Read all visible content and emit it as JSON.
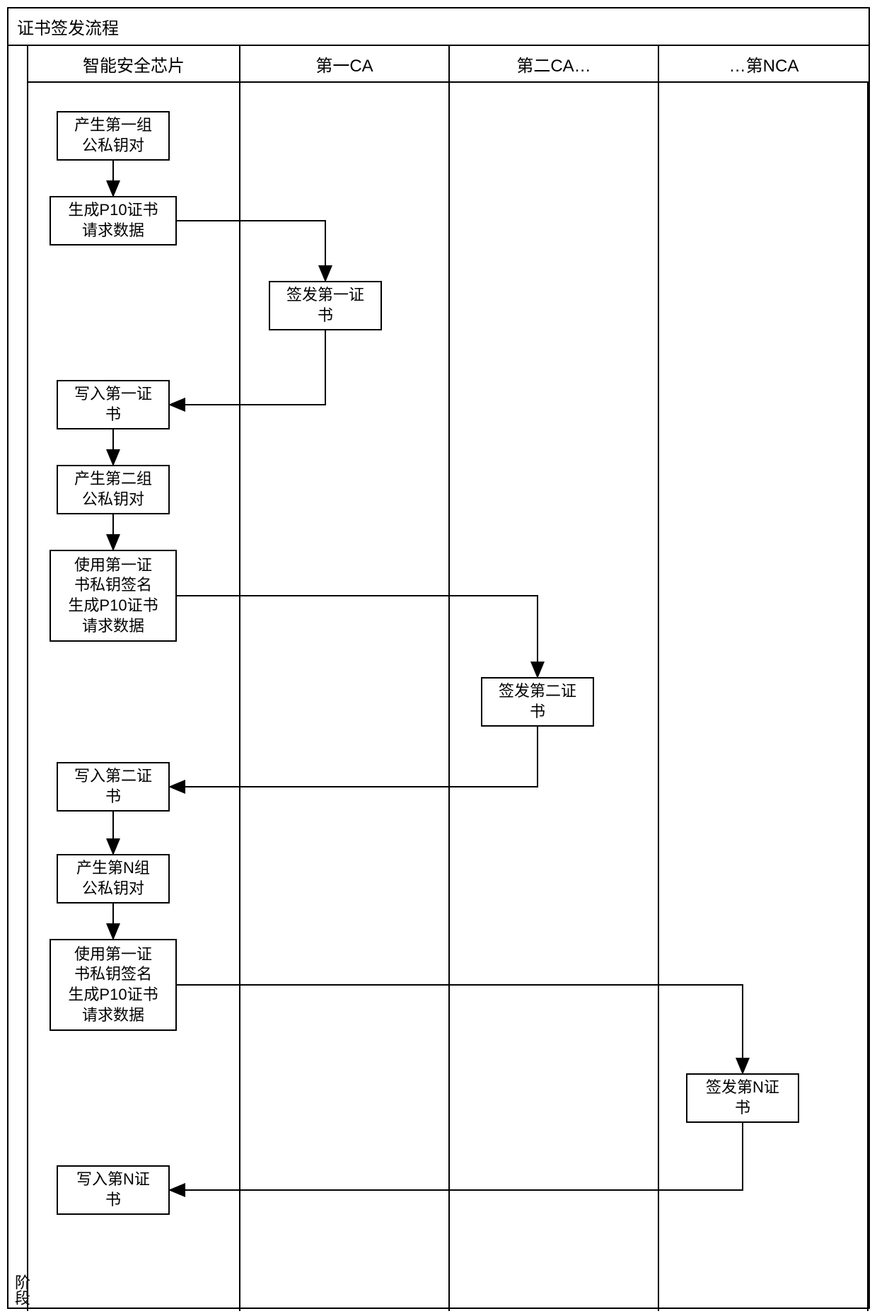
{
  "title": "证书签发流程",
  "phase_label": "阶段",
  "lanes": {
    "chip": "智能安全芯片",
    "ca1": "第一CA",
    "ca2": "第二CA…",
    "caN": "…第NCA"
  },
  "nodes": {
    "gen_key1": "产生第一组\n公私钥对",
    "p10_1": "生成P10证书\n请求数据",
    "issue1": "签发第一证\n书",
    "write1": "写入第一证\n书",
    "gen_key2": "产生第二组\n公私钥对",
    "p10_2": "使用第一证\n书私钥签名\n生成P10证书\n请求数据",
    "issue2": "签发第二证\n书",
    "write2": "写入第二证\n书",
    "gen_keyN": "产生第N组\n公私钥对",
    "p10_N": "使用第一证\n书私钥签名\n生成P10证书\n请求数据",
    "issueN": "签发第N证\n书",
    "writeN": "写入第N证\n书"
  }
}
